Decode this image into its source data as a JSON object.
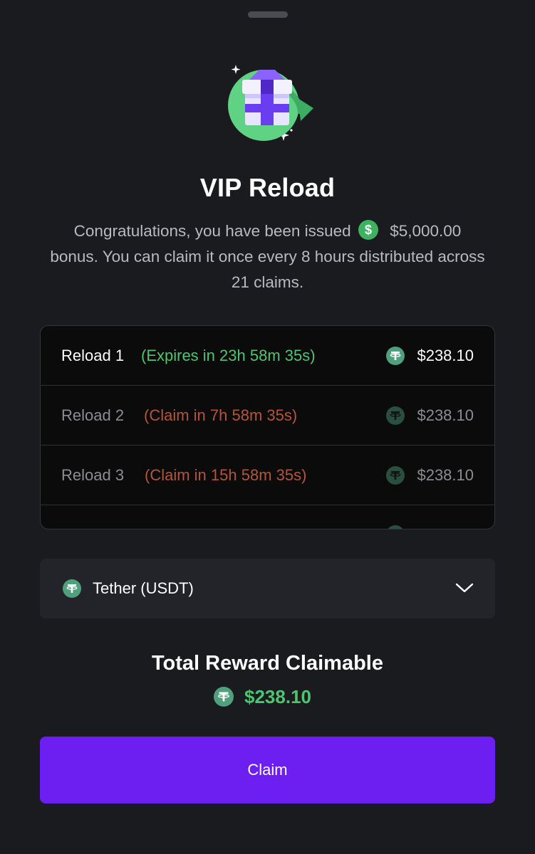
{
  "modal": {
    "title": "VIP Reload",
    "description_before": "Congratulations, you have been issued",
    "bonus_amount": "$5,000.00",
    "description_after": "bonus. You can claim it once every 8 hours distributed across 21 claims.",
    "hero_icon": "gift-reload-icon",
    "bonus_coin_icon": "dollar-coin-icon"
  },
  "reloads": [
    {
      "label": "Reload 1",
      "status": "(Expires in 23h 58m 35s)",
      "amount": "$238.10",
      "state": "active",
      "icon": "tether-icon"
    },
    {
      "label": "Reload 2",
      "status": "(Claim in 7h 58m 35s)",
      "amount": "$238.10",
      "state": "locked",
      "icon": "tether-icon"
    },
    {
      "label": "Reload 3",
      "status": "(Claim in 15h 58m 35s)",
      "amount": "$238.10",
      "state": "locked",
      "icon": "tether-icon"
    }
  ],
  "currency_select": {
    "label": "Tether (USDT)",
    "icon": "tether-icon",
    "chevron_icon": "chevron-down-icon"
  },
  "total": {
    "title": "Total Reward Claimable",
    "amount": "$238.10",
    "icon": "tether-icon"
  },
  "claim_button": {
    "label": "Claim"
  },
  "colors": {
    "background": "#1a1b1e",
    "accent_purple": "#6c1ff0",
    "green": "#4fc46f",
    "status_red": "#b4553b",
    "tether_green": "#50a07e"
  }
}
